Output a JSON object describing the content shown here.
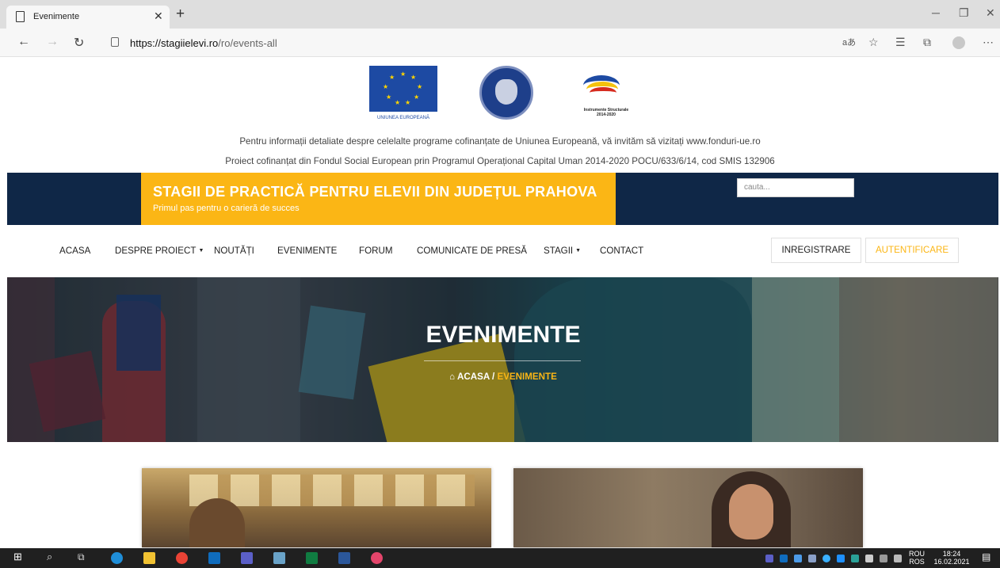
{
  "browser": {
    "tab_title": "Evenimente",
    "url_domain": "https://stagiielevi.ro",
    "url_path": "/ro/events-all"
  },
  "logos": {
    "eu_caption": "UNIUNEA EUROPEANĂ",
    "structural_caption_1": "Instrumente Structurale",
    "structural_caption_2": "2014-2020"
  },
  "info": {
    "line1": "Pentru informații detaliate despre celelalte programe cofinanțate de Uniunea Europeană, vă invităm să vizitați www.fonduri-ue.ro",
    "line2": "Proiect cofinanțat din Fondul Social European prin Programul Operațional Capital Uman 2014-2020 POCU/633/6/14, cod SMIS 132906"
  },
  "banner": {
    "title": "STAGII DE PRACTICĂ PENTRU ELEVII DIN JUDEȚUL PRAHOVA",
    "subtitle": "Primul pas pentru o carieră de succes",
    "search_placeholder": "cauta..."
  },
  "nav": {
    "items": [
      "ACASA",
      "DESPRE PROIECT",
      "NOUTĂȚI",
      "EVENIMENTE",
      "FORUM",
      "COMUNICATE DE PRESĂ",
      "STAGII",
      "CONTACT"
    ],
    "register": "INREGISTRARE",
    "login": "AUTENTIFICARE"
  },
  "hero": {
    "title": "EVENIMENTE",
    "crumb_home": "ACASA",
    "crumb_sep": "/",
    "crumb_current": "EVENIMENTE"
  },
  "taskbar": {
    "lang_top": "ROU",
    "lang_bottom": "ROS",
    "time": "18:24",
    "date": "16.02.2021"
  },
  "colors": {
    "accent_yellow": "#fbb615",
    "banner_navy": "#0f2747"
  }
}
